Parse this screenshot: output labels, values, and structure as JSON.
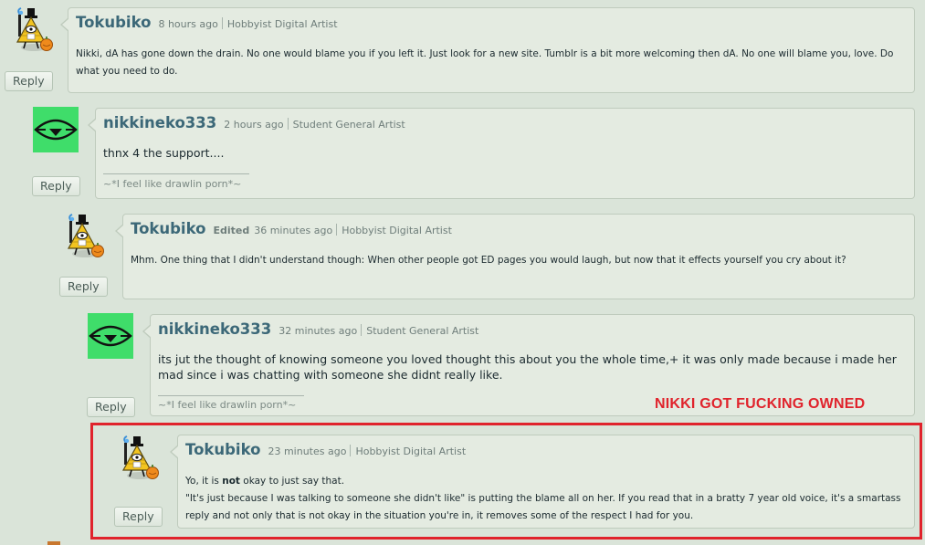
{
  "comments": [
    {
      "author": "Tokubiko",
      "edited": "",
      "time": "8 hours ago",
      "role": "Hobbyist Digital Artist",
      "body": "Nikki, dA has gone down the drain. No one would blame you if you left it. Just look for a new site. Tumblr is a bit more welcoming then dA. No one will blame you, love. Do what you need to do.",
      "reply": "Reply",
      "avatar": "bill-cipher-pumpkin-icon"
    },
    {
      "author": "nikkineko333",
      "edited": "",
      "time": "2 hours ago",
      "role": "Student General Artist",
      "body": "thnx 4 the support....",
      "signature": "~*I feel like drawlin porn*~",
      "reply": "Reply",
      "avatar": "green-eye-icon"
    },
    {
      "author": "Tokubiko",
      "edited": "Edited",
      "time": "36 minutes ago",
      "role": "Hobbyist Digital Artist",
      "body": "Mhm. One thing that I didn't understand though: When other people got ED pages you would laugh, but now that it effects yourself you cry about it?",
      "reply": "Reply",
      "avatar": "bill-cipher-pumpkin-icon"
    },
    {
      "author": "nikkineko333",
      "edited": "",
      "time": "32 minutes ago",
      "role": "Student General Artist",
      "body": "its jut the thought of knowing someone you loved thought this about you the whole time,+ it was only made because i made her mad since i was chatting with someone she didnt really like.",
      "signature": "~*I feel like drawlin porn*~",
      "reply": "Reply",
      "avatar": "green-eye-icon"
    },
    {
      "author": "Tokubiko",
      "edited": "",
      "time": "23 minutes ago",
      "role": "Hobbyist Digital Artist",
      "body_pre": "Yo, it is ",
      "body_bold": "not",
      "body_post": " okay to just say that.",
      "body2": "\"It's just because I was talking to someone she didn't like\" is putting the blame all on her. If you read that in a bratty 7 year old voice, it's a smartass reply and not only that is not okay in the situation you're in, it removes some of the respect I had for you.",
      "reply": "Reply",
      "avatar": "bill-cipher-pumpkin-icon"
    }
  ],
  "annotation": {
    "text": "NIKKI GOT FUCKING OWNED",
    "color": "#e0232c"
  },
  "colors": {
    "username": "#3c6878",
    "background": "#dae4d9",
    "bubble": "#e4ebe1"
  }
}
